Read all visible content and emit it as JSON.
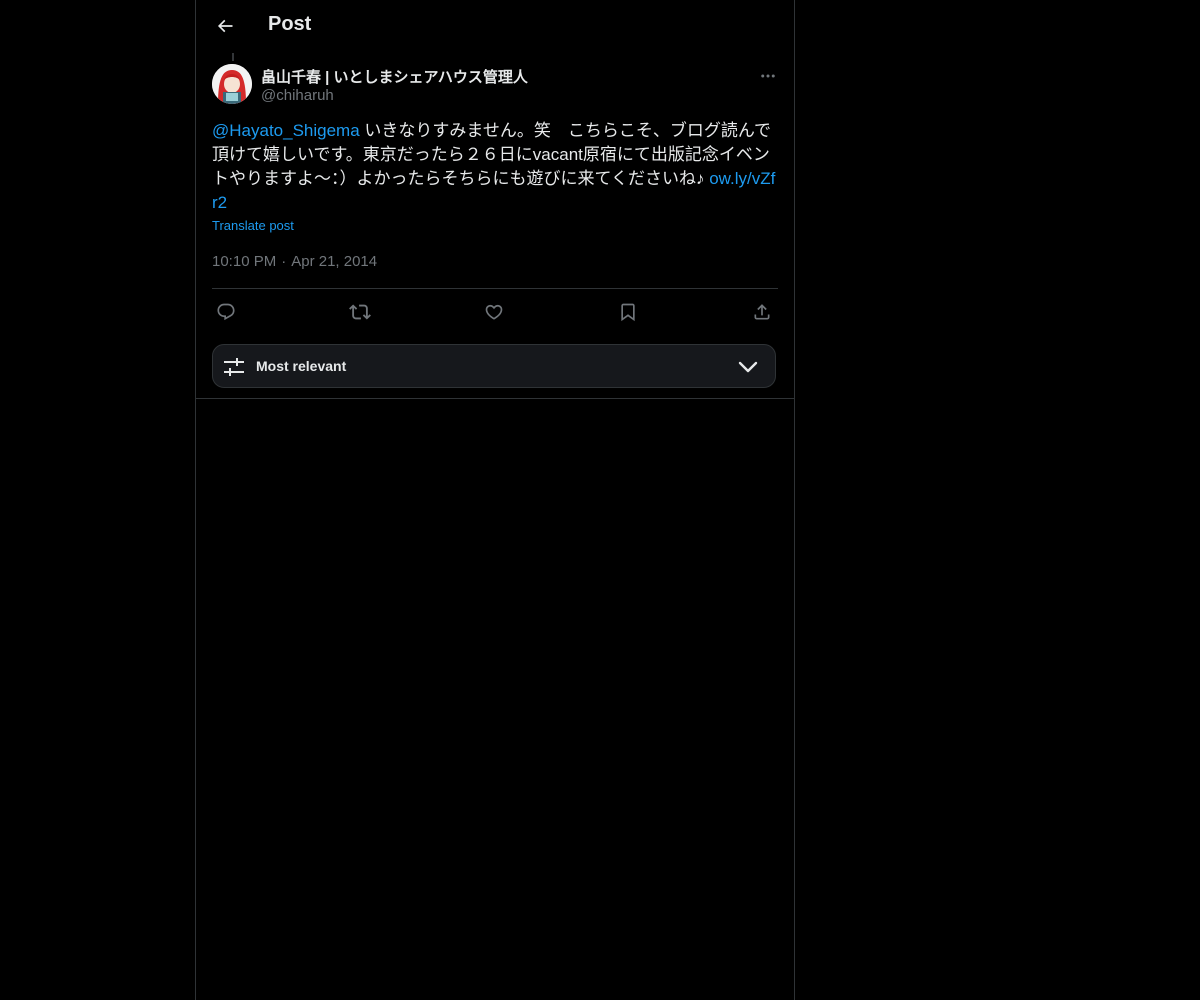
{
  "header": {
    "title": "Post",
    "back_icon": "arrow-left-icon"
  },
  "post": {
    "author_name": "畠山千春 | いとしまシェアハウス管理人",
    "author_handle": "@chiharuh",
    "mention": "@Hayato_Shigema",
    "text": " いきなりすみません。笑　こちらこそ、ブログ読んで頂けて嬉しいです。東京だったら２６日にvacant原宿にて出版記念イベントやりますよ〜：）よかったらそちらにも遊びに来てくださいね♪ ",
    "link": "ow.ly/vZfr2",
    "translate_label": "Translate post",
    "time": "10:10 PM",
    "separator": "·",
    "date": "Apr 21, 2014"
  },
  "actions": [
    {
      "name": "reply",
      "icon": "reply-icon"
    },
    {
      "name": "repost",
      "icon": "repost-icon"
    },
    {
      "name": "like",
      "icon": "heart-icon"
    },
    {
      "name": "bookmark",
      "icon": "bookmark-icon"
    },
    {
      "name": "share",
      "icon": "share-icon"
    }
  ],
  "sort": {
    "label": "Most relevant",
    "icon": "sliders-icon",
    "chevron": "chevron-down-icon"
  },
  "colors": {
    "background": "#000000",
    "text": "#e7e9ea",
    "muted": "#71767b",
    "accent": "#1d9bf0",
    "border": "#2f3336"
  }
}
